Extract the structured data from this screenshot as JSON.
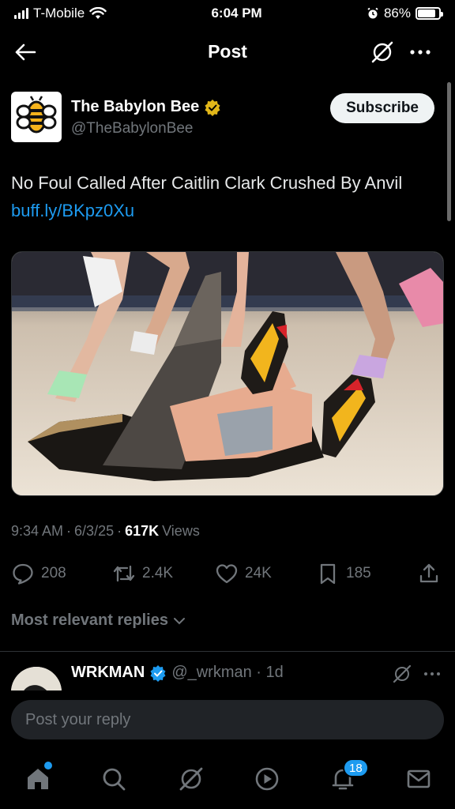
{
  "status_bar": {
    "carrier": "T-Mobile",
    "time": "6:04 PM",
    "battery_percent": "86%",
    "battery_level": 0.86,
    "signal_bars": 4
  },
  "header": {
    "title": "Post",
    "back_icon": "arrow-left-icon",
    "grok_icon": "grok-icon",
    "more_icon": "more-horizontal-icon"
  },
  "author": {
    "name": "The Babylon Bee",
    "handle": "@TheBabylonBee",
    "verified": "gold-check-badge",
    "subscribe_label": "Subscribe"
  },
  "post": {
    "text": "No Foul Called After Caitlin Clark Crushed By Anvil ",
    "link_text": "buff.ly/BKpz0Xu"
  },
  "meta": {
    "time": "9:34 AM",
    "sep1": "·",
    "date": "6/3/25",
    "sep2": "·",
    "views_count": "617K",
    "views_label": "Views"
  },
  "actions": {
    "replies": "208",
    "reposts": "2.4K",
    "likes": "24K",
    "bookmarks": "185"
  },
  "replies_filter": {
    "label": "Most relevant replies"
  },
  "reply_preview": {
    "name": "WRKMAN",
    "handle": "@_wrkman · 1d"
  },
  "composer": {
    "placeholder": "Post your reply"
  },
  "bottom_nav": {
    "items": [
      "home-icon",
      "search-icon",
      "grok-icon",
      "video-icon",
      "notifications-icon",
      "messages-icon"
    ],
    "notifications_badge": "18"
  },
  "colors": {
    "background": "#000000",
    "accent": "#1d9bf0",
    "muted": "#71767b",
    "gold_badge": "#e2b719"
  }
}
